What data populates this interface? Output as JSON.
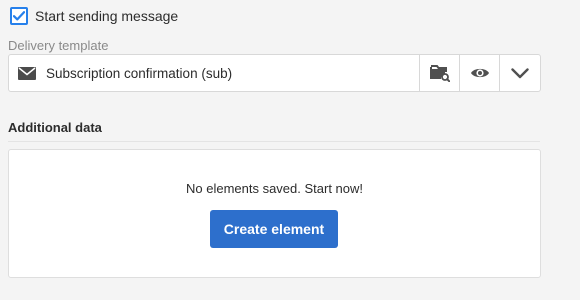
{
  "send_option": {
    "label": "Start sending message",
    "checked": true
  },
  "delivery_template": {
    "label": "Delivery template",
    "value": "Subscription confirmation (sub)",
    "icon": "envelope-icon",
    "actions": [
      "folder-search-icon",
      "eye-icon",
      "chevron-down-icon"
    ]
  },
  "additional_data": {
    "title": "Additional data",
    "empty_message": "No elements saved. Start now!",
    "create_button_label": "Create element"
  },
  "colors": {
    "accent": "#2680eb",
    "button": "#2d6fcc"
  }
}
